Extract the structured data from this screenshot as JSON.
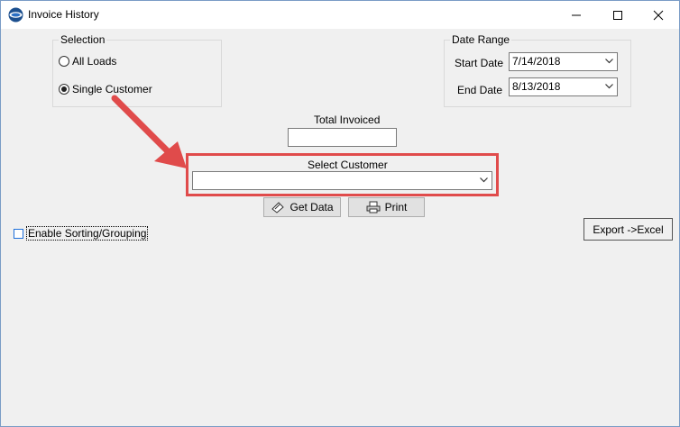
{
  "window": {
    "title": "Invoice History",
    "app_icon": "app-logo-icon",
    "controls": [
      "minimize-icon",
      "maximize-icon",
      "close-icon"
    ]
  },
  "selection": {
    "legend": "Selection",
    "options": [
      {
        "label": "All Loads",
        "checked": false
      },
      {
        "label": "Single Customer",
        "checked": true
      }
    ]
  },
  "date_range": {
    "legend": "Date Range",
    "start_label": "Start Date",
    "start_value": "7/14/2018",
    "end_label": "End Date",
    "end_value": "8/13/2018"
  },
  "total_invoiced": {
    "label": "Total Invoiced",
    "value": ""
  },
  "select_customer": {
    "label": "Select Customer",
    "value": ""
  },
  "buttons": {
    "get_data": "Get Data",
    "print": "Print",
    "export_excel": "Export ->Excel"
  },
  "enable_sorting": {
    "label": "Enable Sorting/Grouping",
    "checked": false
  },
  "annotation": {
    "color": "#e04b4b"
  }
}
